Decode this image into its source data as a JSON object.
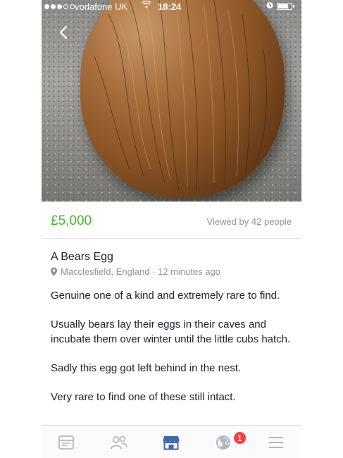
{
  "status_bar": {
    "carrier": "vodafone UK",
    "time": "18:24",
    "signal_bars_filled": 3,
    "signal_bars_total": 5,
    "battery_level": 0.75
  },
  "listing": {
    "price": "£5,000",
    "views_text": "Viewed by 42 people",
    "title": "A Bears Egg",
    "location": "Macclesfield, England · 12 minutes ago",
    "description": [
      "Genuine one of a kind and extremely rare to find.",
      "Usually bears lay their eggs in their caves and incubate them over winter until the little cubs hatch.",
      "Sadly this egg got left behind in the nest.",
      "Very rare to find one of these still intact."
    ]
  },
  "tabbar": {
    "tabs": [
      {
        "icon": "news-feed-icon"
      },
      {
        "icon": "friends-icon"
      },
      {
        "icon": "marketplace-icon",
        "active": true
      },
      {
        "icon": "notifications-globe-icon",
        "badge": "1"
      },
      {
        "icon": "menu-icon"
      }
    ]
  },
  "colors": {
    "price_green": "#42b72a",
    "active_tab_blue": "#4267b2",
    "badge_red": "#fa3e3e",
    "secondary_text": "#90949c"
  }
}
